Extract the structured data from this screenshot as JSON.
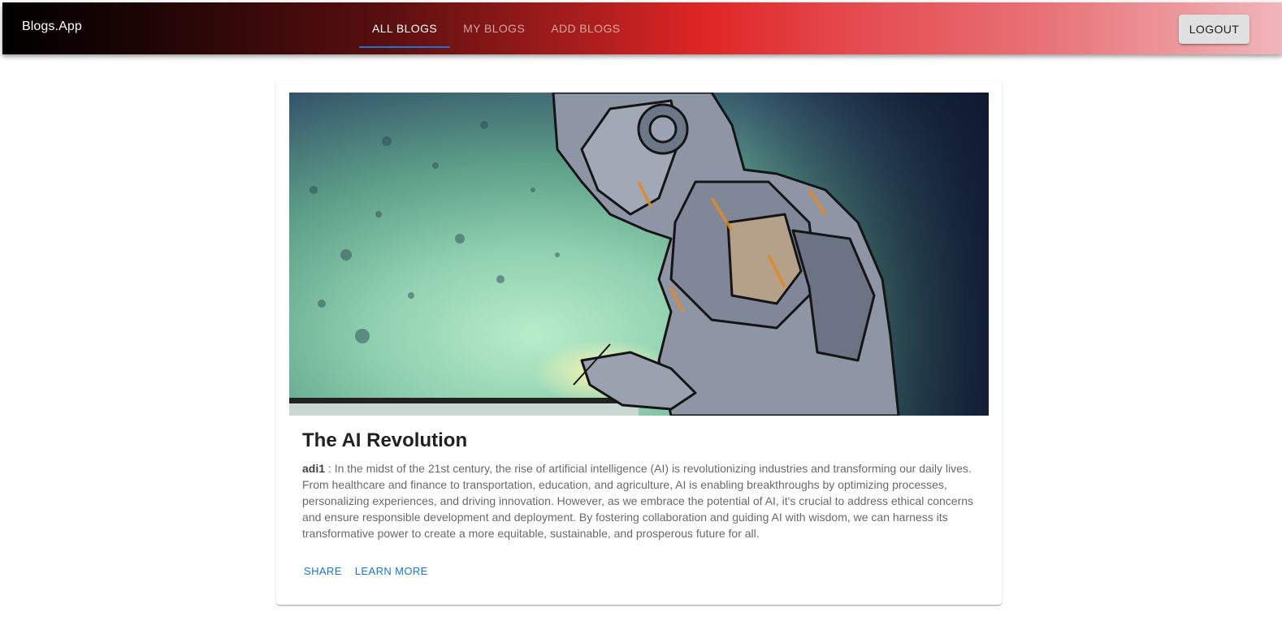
{
  "header": {
    "brand": "Blogs.App",
    "tabs": [
      {
        "label": "ALL BLOGS",
        "active": true
      },
      {
        "label": "MY BLOGS",
        "active": false
      },
      {
        "label": "ADD BLOGS",
        "active": false
      }
    ],
    "logout_label": "LOGOUT"
  },
  "blog": {
    "image_icon": "robot-illustration",
    "title": "The AI Revolution",
    "author": "adi1",
    "separator": " : ",
    "body": "In the midst of the 21st century, the rise of artificial intelligence (AI) is revolutionizing industries and transforming our daily lives. From healthcare and finance to transportation, education, and agriculture, AI is enabling breakthroughs by optimizing processes, personalizing experiences, and driving innovation. However, as we embrace the potential of AI, it's crucial to address ethical concerns and ensure responsible development and deployment. By fostering collaboration and guiding AI with wisdom, we can harness its transformative power to create a more equitable, sustainable, and prosperous future for all.",
    "actions": {
      "share_label": "SHARE",
      "learn_more_label": "LEARN MORE"
    }
  },
  "colors": {
    "accent": "#1976d2",
    "header_start": "#000000",
    "header_mid": "#e02626",
    "header_end": "#f0b6ba"
  }
}
